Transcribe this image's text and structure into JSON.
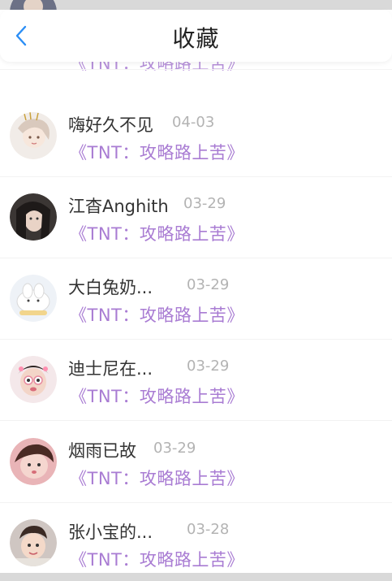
{
  "header": {
    "title": "收藏"
  },
  "items": [
    {
      "name": "",
      "date": "",
      "note": "《TNT：攻略路上苦》"
    },
    {
      "name": "嗨好久不见",
      "date": "04-03",
      "note": "《TNT：攻略路上苦》"
    },
    {
      "name": "江杳Anghith",
      "date": "03-29",
      "note": "《TNT：攻略路上苦》"
    },
    {
      "name": "大白兔奶...",
      "date": "03-29",
      "note": "《TNT：攻略路上苦》"
    },
    {
      "name": "迪士尼在...",
      "date": "03-29",
      "note": "《TNT：攻略路上苦》"
    },
    {
      "name": "烟雨已故",
      "date": "03-29",
      "note": "《TNT：攻略路上苦》"
    },
    {
      "name": "张小宝的...",
      "date": "03-28",
      "note": "《TNT：攻略路上苦》"
    }
  ],
  "colors": {
    "note": "#a97cd3",
    "back_icon": "#2b8ef5",
    "date": "#b3b3b3"
  }
}
